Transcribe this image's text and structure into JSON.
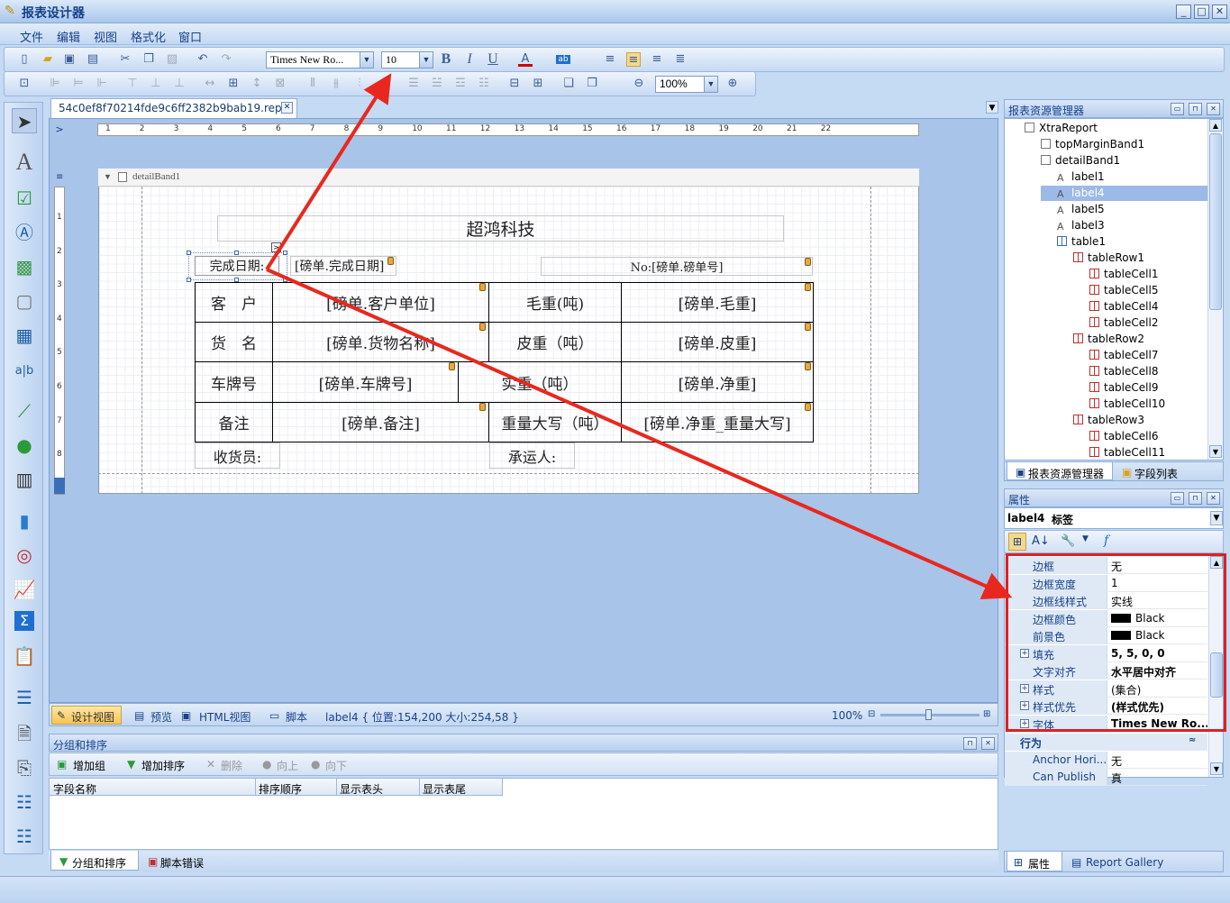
{
  "app": {
    "title": "报表设计器"
  },
  "menu": [
    "文件",
    "编辑",
    "视图",
    "格式化",
    "窗口"
  ],
  "toolbar": {
    "font_name": "Times New Ro...",
    "font_size": "10",
    "zoom": "100%"
  },
  "document_tab": "54c0ef8f70214fde9c6ff2382b9bab19.repx*",
  "ruler": [
    "1",
    "2",
    "3",
    "4",
    "5",
    "6",
    "7",
    "8",
    "9",
    "10",
    "11",
    "12",
    "13",
    "14",
    "15",
    "16",
    "17",
    "18",
    "19",
    "20",
    "21",
    "22"
  ],
  "vruler": [
    "1",
    "2",
    "3",
    "4",
    "5",
    "6",
    "7",
    "8"
  ],
  "band": "detailBand1",
  "report": {
    "title": "超鸿科技",
    "date_label": "完成日期:",
    "date_value": "[磅单.完成日期]",
    "no_value": "No:[磅单.磅单号]",
    "rows": [
      [
        "客　户",
        "[磅单.客户单位]",
        "毛重(吨)",
        "[磅单.毛重]"
      ],
      [
        "货　名",
        "[磅单.货物名称]",
        "皮重（吨）",
        "[磅单.皮重]"
      ],
      [
        "车牌号",
        "[磅单.车牌号]",
        "实重（吨）",
        "[磅单.净重]"
      ],
      [
        "备注",
        "[磅单.备注]",
        "重量大写（吨）",
        "[磅单.净重_重量大写]"
      ]
    ],
    "receiver": "收货员:",
    "carrier": "承运人:"
  },
  "status": {
    "design_view": "设计视图",
    "preview": "预览",
    "html_view": "HTML视图",
    "script": "脚本",
    "info": "label4 { 位置:154,200 大小:254,58 }",
    "zoom": "100%"
  },
  "grouping": {
    "title": "分组和排序",
    "add_group": "增加组",
    "add_sort": "增加排序",
    "delete": "删除",
    "up": "向上",
    "down": "向下",
    "columns": [
      "字段名称",
      "排序顺序",
      "显示表头",
      "显示表尾"
    ],
    "tabs": [
      "分组和排序",
      "脚本错误"
    ]
  },
  "explorer": {
    "title": "报表资源管理器",
    "nodes": [
      "XtraReport",
      "topMarginBand1",
      "detailBand1",
      "label1",
      "label4",
      "label5",
      "label3",
      "table1",
      "tableRow1",
      "tableCell1",
      "tableCell5",
      "tableCell4",
      "tableCell2",
      "tableRow2",
      "tableCell7",
      "tableCell8",
      "tableCell9",
      "tableCell10",
      "tableRow3",
      "tableCell6",
      "tableCell11"
    ],
    "tabs": [
      "报表资源管理器",
      "字段列表"
    ]
  },
  "properties": {
    "title": "属性",
    "object_name": "label4",
    "object_type": "标签",
    "rows": [
      {
        "k": "边框",
        "v": "无",
        "exp": false,
        "bold": false,
        "swatch": false
      },
      {
        "k": "边框宽度",
        "v": "1",
        "exp": false,
        "bold": false,
        "swatch": false
      },
      {
        "k": "边框线样式",
        "v": "实线",
        "exp": false,
        "bold": false,
        "swatch": false
      },
      {
        "k": "边框颜色",
        "v": "Black",
        "exp": false,
        "bold": false,
        "swatch": true
      },
      {
        "k": "前景色",
        "v": "Black",
        "exp": false,
        "bold": false,
        "swatch": true
      },
      {
        "k": "填充",
        "v": "5, 5, 0, 0",
        "exp": true,
        "bold": true,
        "swatch": false
      },
      {
        "k": "文字对齐",
        "v": "水平居中对齐",
        "exp": false,
        "bold": true,
        "swatch": false
      },
      {
        "k": "样式",
        "v": "(集合)",
        "exp": true,
        "bold": false,
        "swatch": false
      },
      {
        "k": "样式优先",
        "v": "(样式优先)",
        "exp": true,
        "bold": true,
        "swatch": false
      },
      {
        "k": "字体",
        "v": "Times New Ro...",
        "exp": true,
        "bold": true,
        "swatch": false
      }
    ],
    "section": "行为",
    "behavior": [
      {
        "k": "Anchor Hori...",
        "v": "无"
      },
      {
        "k": "Can Publish",
        "v": "真"
      }
    ],
    "tabs": [
      "属性",
      "Report Gallery"
    ]
  },
  "colors": {
    "highlight": "#e02020",
    "arrow": "#e8281e",
    "selected": "#9db9e8"
  }
}
